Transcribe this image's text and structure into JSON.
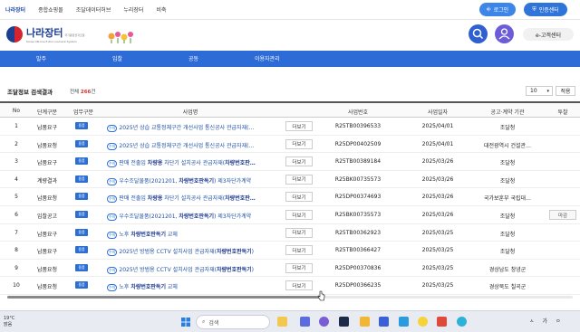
{
  "topnav": {
    "links": [
      "나라장터",
      "종합쇼핑몰",
      "조달데이터허브",
      "누리장터",
      "비축"
    ],
    "login": "로그인",
    "cert": "인증센터"
  },
  "header": {
    "logo_title": "나라장터",
    "logo_small": "국가종합전자조달",
    "logo_sub": "Korea ON-line E-Procurement System",
    "customer_center": "e-고객센터"
  },
  "menu": [
    "발주",
    "입찰",
    "공동",
    "이용자관리"
  ],
  "results": {
    "title": "조달정보 검색결과",
    "count_prefix": "전체",
    "count": "266",
    "count_suffix": "건",
    "page_size": "10",
    "apply": "적용"
  },
  "table": {
    "headers": [
      "No",
      "단계구분",
      "업무구분",
      "사업명",
      "사업번호",
      "사업일자",
      "공고·계약 기관",
      "투찰"
    ],
    "more_label": "더보기",
    "deadline_label": "마감",
    "rows": [
      {
        "no": "1",
        "stage": "납품요구",
        "task": "용품",
        "title": "2025년 상습 교통정체구간 개선사업 통신공사 관급자재(…",
        "number": "R25TB00396533",
        "date": "2025/04/01",
        "agency": "조달청"
      },
      {
        "no": "2",
        "stage": "납품요청",
        "task": "용품",
        "title": "2025년 상습 교통정체구간 개선사업 통신공사 관급자재(…",
        "number": "R25DP00402509",
        "date": "2025/04/01",
        "agency": "대전광역시 건설관…"
      },
      {
        "no": "3",
        "stage": "납품요구",
        "task": "용품",
        "title": "판매 전출입 차량용 차단기 설치공사 관급자재(차량번호판…",
        "number": "R25TB00389184",
        "date": "2025/03/26",
        "agency": "조달청"
      },
      {
        "no": "4",
        "stage": "계량결과",
        "task": "용품",
        "title": "우수조달물품(2021201, 차량번호판독기) 제3자단가계약",
        "number": "R25BK00735573",
        "date": "2025/03/26",
        "agency": "조달청"
      },
      {
        "no": "5",
        "stage": "납품요청",
        "task": "용품",
        "title": "판매 전출입 차량용 차단기 설치공사 관급자재(차량번호판…",
        "number": "R25DP00374693",
        "date": "2025/03/26",
        "agency": "국가보훈부 국립대…"
      },
      {
        "no": "6",
        "stage": "입찰공고",
        "task": "용품",
        "title": "우수조달물품(2021201, 차량번호판독기) 제3자단가계약",
        "number": "R25BK00735573",
        "date": "2025/03/26",
        "agency": "조달청",
        "deadline": true
      },
      {
        "no": "7",
        "stage": "납품요구",
        "task": "용품",
        "title": "노후 차량번호판독기 교체",
        "number": "R25TB00362923",
        "date": "2025/03/25",
        "agency": "조달청"
      },
      {
        "no": "8",
        "stage": "납품요구",
        "task": "용품",
        "title": "2025년 방범용 CCTV 설치사업 관급자재(차량번호판독기)",
        "number": "R25TB00366427",
        "date": "2025/03/25",
        "agency": "조달청"
      },
      {
        "no": "9",
        "stage": "납품요청",
        "task": "용품",
        "title": "2025년 방범용 CCTV 설치사업 관급자재(차량번호판독기)",
        "number": "R25DP00370836",
        "date": "2025/03/25",
        "agency": "경상남도 창녕군"
      },
      {
        "no": "10",
        "stage": "납품요청",
        "task": "용품",
        "title": "노후 차량번호판독기 교체",
        "number": "R25DP00366235",
        "date": "2025/03/25",
        "agency": "경상북도 칠곡군"
      }
    ]
  },
  "taskbar": {
    "temp": "19°C",
    "weather": "맑음",
    "search": "검색",
    "tray": [
      "ㅅ",
      "가",
      "ㅇ"
    ]
  },
  "colors": {
    "primary": "#2d6bd6",
    "navy": "#1d3f93",
    "accent_red": "#d63030"
  }
}
